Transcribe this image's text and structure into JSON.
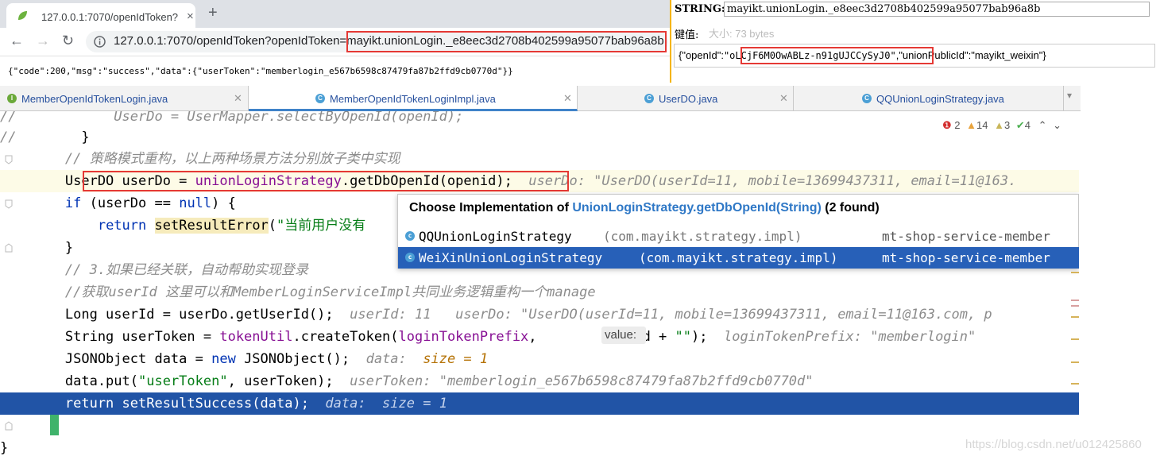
{
  "browser": {
    "tab_title": "127.0.0.1:7070/openIdToken?o",
    "tab_close": "×",
    "new_tab": "+",
    "url": "127.0.0.1:7070/openIdToken?openIdToken=mayikt.unionLogin._e8eec3d2708b402599a95077bab96a8b",
    "page_json": "{\"code\":200,\"msg\":\"success\",\"data\":{\"userToken\":\"memberlogin_e567b6598c87479fa87b2ffd9cb0770d\"}}"
  },
  "redis": {
    "string_label": "STRING:",
    "key_value": "mayikt.unionLogin._e8eec3d2708b402599a95077bab96a8b",
    "value_label": "键值:",
    "size_text": "大小: 73 bytes",
    "value_prefix": "{\"openId\":",
    "openid": "\"oLCjF6M0OwABLz-n91gUJCCySyJ0\"",
    "value_suffix": ",\"unionPublicId\":\"mayikt_weixin\"}"
  },
  "ide": {
    "tabs": [
      {
        "label": "MemberOpenIdTokenLogin.java",
        "icon": "I"
      },
      {
        "label": "MemberOpenIdTokenLoginImpl.java",
        "icon": "C"
      },
      {
        "label": "UserDO.java",
        "icon": "C"
      },
      {
        "label": "QQUnionLoginStrategy.java",
        "icon": "C"
      }
    ],
    "inspections": {
      "errors": "2",
      "warnings": "14",
      "weak": "3",
      "typos": "4"
    },
    "popup": {
      "title_prefix": "Choose Implementation of ",
      "method": "UnionLoginStrategy.getDbOpenId(String)",
      "count": "(2 found)",
      "items": [
        {
          "name": "QQUnionLoginStrategy",
          "pkg": "(com.mayikt.strategy.impl)",
          "module": "mt-shop-service-member"
        },
        {
          "name": "WeiXinUnionLoginStrategy",
          "pkg": "(com.mayikt.strategy.impl)",
          "module": "mt-shop-service-member"
        }
      ]
    },
    "param_hint": "value:",
    "watermark": "https://blog.csdn.net/u012425860"
  }
}
